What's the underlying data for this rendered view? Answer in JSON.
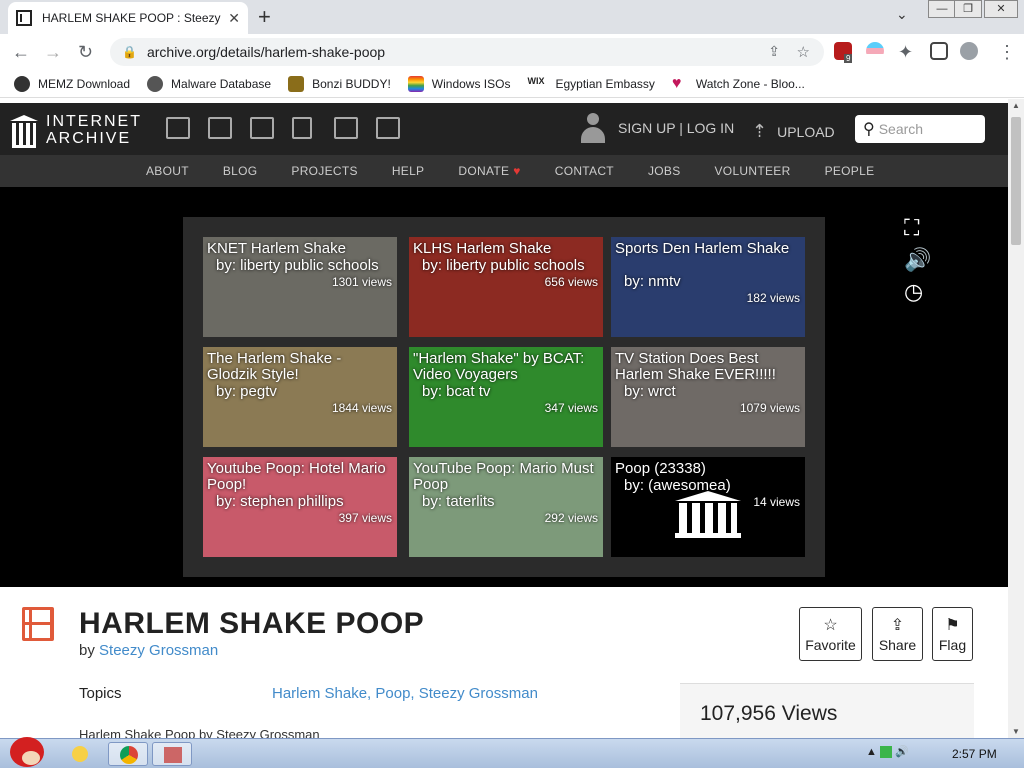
{
  "browser": {
    "tab_title": "HARLEM SHAKE POOP : Steezy Grossman",
    "tab_close": "✕",
    "new_tab": "+",
    "tab_menu": "⌄",
    "url": "archive.org/details/harlem-shake-poop",
    "extensions_badge": "9",
    "window_controls": [
      "—",
      "❐",
      "✕"
    ]
  },
  "bookmarks": [
    {
      "label": "MEMZ Download",
      "color": "#333333"
    },
    {
      "label": "Malware Database",
      "color": "#555555"
    },
    {
      "label": "Bonzi BUDDY!",
      "color": "#8a6d1a"
    },
    {
      "label": "Windows ISOs",
      "color": "#e53935"
    },
    {
      "label": "Egyptian Embassy",
      "color": "#222222"
    },
    {
      "label": "Watch Zone - Bloo...",
      "color": "#c2185b"
    }
  ],
  "ia": {
    "logo_line1": "INTERNET",
    "logo_line2": "ARCHIVE",
    "signin": "SIGN UP | LOG IN",
    "upload": "UPLOAD",
    "search_placeholder": "Search",
    "nav": [
      "ABOUT",
      "BLOG",
      "PROJECTS",
      "HELP",
      "DONATE",
      "CONTACT",
      "JOBS",
      "VOLUNTEER",
      "PEOPLE"
    ]
  },
  "videos": [
    {
      "title": "KNET Harlem Shake",
      "by": "by: liberty public schools",
      "views": "1301 views",
      "bg": "#6b6a63"
    },
    {
      "title": "KLHS Harlem Shake",
      "by": "by: liberty public schools",
      "views": "656 views",
      "bg": "#8c2a22"
    },
    {
      "title": "Sports Den Harlem Shake",
      "by": "by: nmtv",
      "views": "182 views",
      "bg": "#2a3d6e"
    },
    {
      "title": "The Harlem Shake - Glodzik Style!",
      "by": "by: pegtv",
      "views": "1844 views",
      "bg": "#8b7a54"
    },
    {
      "title": "\"Harlem Shake\" by BCAT: Video Voyagers",
      "by": "by: bcat tv",
      "views": "347 views",
      "bg": "#2f8a2c"
    },
    {
      "title": "TV Station Does Best Harlem Shake EVER!!!!!",
      "by": "by: wrct",
      "views": "1079 views",
      "bg": "#6f6a66"
    },
    {
      "title": "Youtube Poop: Hotel Mario Poop!",
      "by": "by: stephen phillips",
      "views": "397 views",
      "bg": "#c85a6a"
    },
    {
      "title": "YouTube Poop: Mario Must Poop",
      "by": "by: taterlits",
      "views": "292 views",
      "bg": "#7d9a7a"
    },
    {
      "title": "Poop (23338)",
      "by": "by: (awesomea)",
      "views": "14 views",
      "bg": "#000000"
    }
  ],
  "item": {
    "title": "HARLEM SHAKE POOP",
    "by_prefix": "by",
    "author": "Steezy Grossman",
    "topics_label": "Topics",
    "topics": "Harlem Shake, Poop, Steezy Grossman",
    "views": "107,956 Views",
    "description": "Harlem Shake Poop by Steezy Grossman",
    "actions": [
      "Favorite",
      "Share",
      "Flag"
    ]
  },
  "taskbar": {
    "time": "2:57 PM"
  }
}
